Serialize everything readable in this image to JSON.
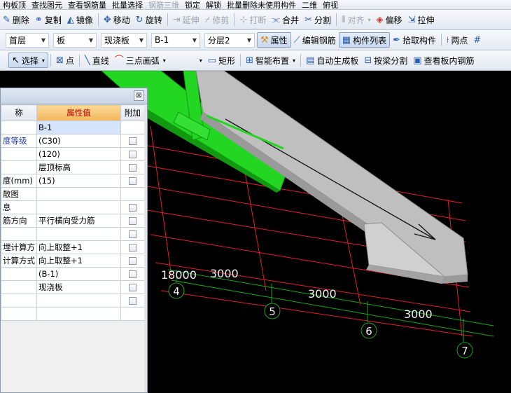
{
  "toolbar1": {
    "items": [
      "构板顶",
      "查找图元",
      "查看钢筋量",
      "批量选择",
      "钢筋三维",
      "锁定",
      "解锁",
      "批量删除未使用构件",
      "二维",
      "俯视"
    ]
  },
  "toolbar2": {
    "delete": "删除",
    "copy": "复制",
    "mirror": "镜像",
    "move": "移动",
    "rotate": "旋转",
    "extend": "延伸",
    "trim": "修剪",
    "break": "打断",
    "merge": "合并",
    "split": "分割",
    "align": "对齐",
    "offset": "偏移",
    "stretch": "拉伸"
  },
  "toolbar3": {
    "floor": "首层",
    "type": "板",
    "subtype": "现浇板",
    "component": "B-1",
    "layer": "分层2",
    "properties": "属性",
    "edit_rebar": "编辑钢筋",
    "component_list": "构件列表",
    "pick_component": "拾取构件",
    "two_points": "两点"
  },
  "toolbar4": {
    "select": "选择",
    "point": "点",
    "line": "直线",
    "arc": "三点画弧",
    "rect": "矩形",
    "smart_layout": "智能布置",
    "auto_gen": "自动生成板",
    "beam_split": "按梁分割",
    "view_rebar": "查看板内钢筋"
  },
  "panel": {
    "close": "⊠",
    "headers": {
      "name": "称",
      "value": "属性值",
      "extra": "附加"
    },
    "rows": [
      {
        "name": "",
        "value": "B-1",
        "check": false,
        "sel": true
      },
      {
        "name": "度等级",
        "value": "(C30)",
        "check": true,
        "blue": true
      },
      {
        "name": "",
        "value": "(120)",
        "check": true
      },
      {
        "name": "",
        "value": "层顶标高",
        "check": true
      },
      {
        "name": "度(mm)",
        "value": "(15)",
        "check": true
      },
      {
        "name": "散图",
        "value": "",
        "check": false
      },
      {
        "name": "息",
        "value": "",
        "check": true
      },
      {
        "name": "筋方向",
        "value": "平行横向受力筋",
        "check": true
      },
      {
        "name": "",
        "value": "",
        "check": true
      },
      {
        "name": "埋计算方",
        "value": "向上取整+1",
        "check": true
      },
      {
        "name": "计算方式",
        "value": "向上取整+1",
        "check": true
      },
      {
        "name": "",
        "value": "(B-1)",
        "check": true
      },
      {
        "name": "",
        "value": "现浇板",
        "check": true
      },
      {
        "name": "",
        "value": "",
        "check": true
      },
      {
        "name": "",
        "value": "",
        "check": false
      }
    ]
  },
  "viewport": {
    "dims": [
      "18000",
      "3000",
      "3000",
      "3000"
    ],
    "axes": [
      "4",
      "5",
      "6",
      "7"
    ]
  }
}
